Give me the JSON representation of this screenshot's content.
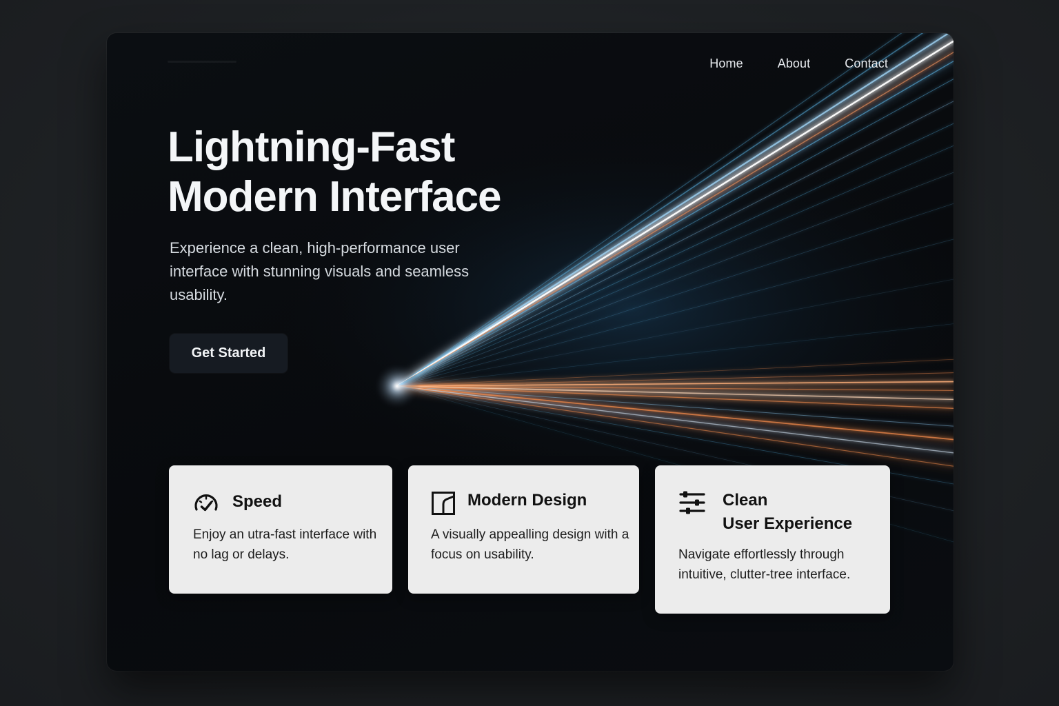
{
  "nav": {
    "items": [
      "Home",
      "About",
      "Contact"
    ]
  },
  "hero": {
    "title_line1": "Lightning-Fast",
    "title_line2": "Modern Interface",
    "subtitle": "Experience a clean, high-performance user interface with stunning visuals and seamless usability.",
    "cta_label": "Get Started"
  },
  "features": [
    {
      "icon": "speedometer-icon",
      "title": "Speed",
      "description": "Enjoy an utra-fast interface with no lag or delays."
    },
    {
      "icon": "design-frame-icon",
      "title": "Modern Design",
      "description": "A visually appealling design with a focus on usability."
    },
    {
      "icon": "sliders-icon",
      "title_line1": "Clean",
      "title_line2": "User Experience",
      "description": "Navigate effortlessly through intuitive, clutter-tree interface."
    }
  ],
  "colors": {
    "background": "#1f2225",
    "window": "#0a0d11",
    "card": "#ececec",
    "ray_blue": "#5ab4e6",
    "ray_orange": "#f08a4b",
    "cta_bg": "#161b22"
  }
}
